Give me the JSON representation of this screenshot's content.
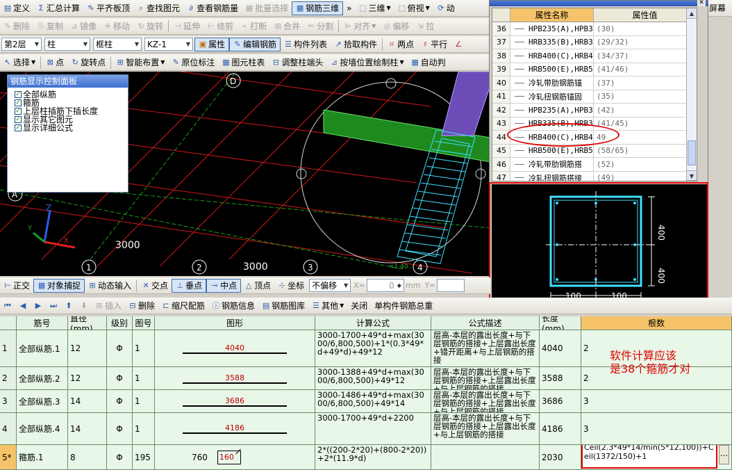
{
  "menu": {
    "items": [
      {
        "icon": "",
        "label": "定义"
      },
      {
        "icon": "Σ",
        "label": "汇总计算"
      },
      {
        "icon": "✎",
        "label": "平齐板顶"
      },
      {
        "icon": "⌕",
        "label": "查找图元"
      },
      {
        "icon": "6d",
        "label": "查看钢筋量"
      },
      {
        "icon": "▦",
        "label": "批量选择"
      },
      {
        "icon": "▦",
        "label": "钢筋三维"
      },
      {
        "icon": "»",
        "label": ""
      },
      {
        "icon": "⬚",
        "label": "三维"
      },
      {
        "icon": "⬚",
        "label": "俯视"
      },
      {
        "icon": "⟳",
        "label": "动"
      }
    ],
    "right_label": "屏幕"
  },
  "toolbar1": {
    "items": [
      "删除",
      "复制",
      "镜像",
      "移动",
      "旋转",
      "延伸",
      "修剪",
      "打断",
      "合并",
      "分割",
      "对齐",
      "偏移",
      "拉"
    ]
  },
  "toolbar2": {
    "floor": "第2层",
    "category": "柱",
    "type": "框柱",
    "element": "KZ-1",
    "attr_btn": "属性",
    "edit_btn": "编辑钢筋",
    "list_btn": "构件列表",
    "pick_btn": "拾取构件",
    "twopoint_btn": "两点",
    "parallel_btn": "平行",
    "more": "点"
  },
  "toolbar3": {
    "select": "选择",
    "point": "点",
    "rotate_point": "旋转点",
    "smart": "智能布置",
    "original": "原位标注",
    "col_table": "图元柱表",
    "adjust": "调整柱端头",
    "by_wall": "按墙位置绘制柱",
    "auto": "自动判"
  },
  "viewport": {
    "axis_letter": "D",
    "axis_a": "A",
    "axis_numbers": [
      "1",
      "2",
      "3",
      "4"
    ],
    "dims": [
      "3000",
      "3000"
    ],
    "coord_z": "Z",
    "coord_x": "X",
    "coord_y": "Y",
    "mini_text": "×1·40..."
  },
  "control_panel": {
    "title": "钢筋显示控制面板",
    "options": [
      "全部纵筋",
      "箍筋",
      "上层柱插筋下插长度",
      "显示其它图元",
      "显示详细公式"
    ]
  },
  "property_window": {
    "col_name": "属性名称",
    "col_value": "属性值",
    "rows": [
      {
        "idx": "36",
        "name": "HPB235(A),HPB3",
        "value": "(30)"
      },
      {
        "idx": "37",
        "name": "HRB335(B),HRB3",
        "value": "(29/32)"
      },
      {
        "idx": "38",
        "name": "HRB400(C),HRB4",
        "value": "(34/37)"
      },
      {
        "idx": "39",
        "name": "HRB500(E),HRB5",
        "value": "(41/46)"
      },
      {
        "idx": "40",
        "name": "冷轧带肋钢筋锚",
        "value": "(37)"
      },
      {
        "idx": "41",
        "name": "冷轧扭钢筋锚固",
        "value": "(35)"
      },
      {
        "idx": "42",
        "name": "HPB235(A),HPB3",
        "value": "(42)"
      },
      {
        "idx": "43",
        "name": "HRB335(B),HRB3",
        "value": "(41/45)"
      },
      {
        "idx": "44",
        "name": "HRB400(C),HRB4",
        "value": "49"
      },
      {
        "idx": "45",
        "name": "HRB500(E),HRB5",
        "value": "(58/65)"
      },
      {
        "idx": "46",
        "name": "冷轧带肋钢筋搭",
        "value": "(52)"
      },
      {
        "idx": "47",
        "name": "冷轧扭钢筋搭接",
        "value": "(49)"
      }
    ],
    "section_dims": {
      "h1": "400",
      "h2": "400",
      "w1": "100",
      "w2": "100"
    }
  },
  "snap_bar": {
    "ortho": "正交",
    "osnap": "对象捕捉",
    "dyn": "动态输入",
    "inter": "交点",
    "perp": "垂点",
    "mid": "中点",
    "vertex": "顶点",
    "coord": "坐标",
    "offset": "不偏移",
    "x_label": "X=",
    "x_value": "0",
    "unit": "mm",
    "y_label": "Y="
  },
  "grid_toolbar": {
    "insert": "插入",
    "delete": "删除",
    "scale": "缩尺配筋",
    "info": "钢筋信息",
    "library": "钢筋图库",
    "other": "其他",
    "close": "关闭",
    "total": "单构件钢筋总重"
  },
  "grid": {
    "columns": [
      "",
      "筋号",
      "直径(mm)",
      "级别",
      "图号",
      "图形",
      "计算公式",
      "公式描述",
      "长度(mm)",
      "根数"
    ],
    "rows": [
      {
        "idx": "1",
        "name": "全部纵筋.1",
        "dia": "12",
        "grade": "Φ",
        "fig": "1",
        "shape": "4040",
        "formula": "3000-1700+49*d+max(3000/6,800,500)+1*(0.3*49*d+49*d)+49*12",
        "desc": "层高-本层的露出长度+与下层钢筋的搭接+上层露出长度+错开距离+与上层钢筋的搭接",
        "len": "4040",
        "count": "2"
      },
      {
        "idx": "2",
        "name": "全部纵筋.2",
        "dia": "12",
        "grade": "Φ",
        "fig": "1",
        "shape": "3588",
        "formula": "3000-1388+49*d+max(3000/6,800,500)+49*12",
        "desc": "层高-本层的露出长度+与下层钢筋的搭接+上层露出长度+与上层钢筋的搭接",
        "len": "3588",
        "count": "2"
      },
      {
        "idx": "3",
        "name": "全部纵筋.3",
        "dia": "14",
        "grade": "Φ",
        "fig": "1",
        "shape": "3686",
        "formula": "3000-1486+49*d+max(3000/6,800,500)+49*14",
        "desc": "层高-本层的露出长度+与下层钢筋的搭接+上层露出长度+与上层钢筋的搭接",
        "len": "3686",
        "count": "3"
      },
      {
        "idx": "4",
        "name": "全部纵筋.4",
        "dia": "14",
        "grade": "Φ",
        "fig": "1",
        "shape": "4186",
        "formula": "3000-1700+49*d+2200",
        "desc": "层高-本层的露出长度+与下层钢筋的搭接+上层露出长度+与上层钢筋的搭接",
        "len": "4186",
        "count": "3"
      },
      {
        "idx": "5*",
        "name": "箍筋.1",
        "dia": "8",
        "grade": "Φ",
        "fig": "195",
        "shape_a": "760",
        "shape_b": "160",
        "formula": "2*((200-2*20)+(800-2*20))+2*(11.9*d)",
        "desc": "",
        "len": "2030",
        "count": "Ceil(2.3*49*14/min(5*12,100))+Ceil(1372/150)+1",
        "count_btn": "..."
      }
    ]
  },
  "annotation": {
    "line1": "软件计算应该",
    "line2": "是38个箍筋才对"
  },
  "colors": {
    "grid_green": "#e8f7e8",
    "header_orange": "#f6c36a",
    "annotation_red": "#e00000",
    "rebar_cyan": "#3fe0ff",
    "beam_green": "#1e8a1e",
    "column_purple": "#7b58c8"
  }
}
